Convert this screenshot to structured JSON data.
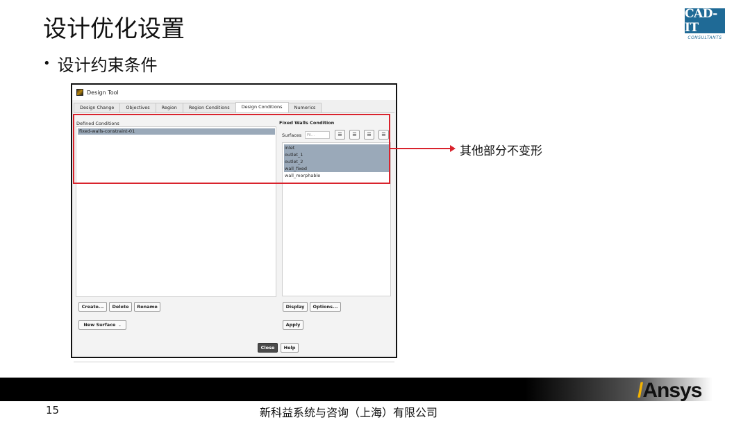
{
  "slide": {
    "title": "设计优化设置",
    "bullet": "设计约束条件",
    "page_number": "15",
    "footer_company": "新科益系统与咨询（上海）有限公司",
    "annotation": "其他部分不变形"
  },
  "logo": {
    "text": "CAD-IT",
    "subtext": "CONSULTANTS",
    "brand": "Ansys"
  },
  "dialog": {
    "title": "Design Tool",
    "tabs": [
      "Design Change",
      "Objectives",
      "Region",
      "Region Conditions",
      "Design Conditions",
      "Numerics"
    ],
    "active_tab": "Design Conditions",
    "defined_conditions_label": "Defined Conditions",
    "defined_conditions": [
      "fixed-walls-constraint-01"
    ],
    "fixed_walls_label": "Fixed Walls Condition",
    "surfaces_label": "Surfaces",
    "filter_placeholder": "Fil...",
    "surfaces": [
      {
        "name": "inlet",
        "selected": true
      },
      {
        "name": "outlet_1",
        "selected": true
      },
      {
        "name": "outlet_2",
        "selected": true
      },
      {
        "name": "wall_fixed",
        "selected": true
      },
      {
        "name": "wall_morphable",
        "selected": false
      }
    ],
    "buttons": {
      "create": "Create...",
      "delete": "Delete",
      "rename": "Rename",
      "new_surface": "New Surface",
      "display": "Display",
      "options": "Options...",
      "apply": "Apply",
      "close": "Close",
      "help": "Help"
    }
  },
  "colors": {
    "selection": "#9aa9b9",
    "annotation_red": "#d9232d",
    "logo_blue": "#1f6a96",
    "ansys_yellow": "#f5b400"
  }
}
